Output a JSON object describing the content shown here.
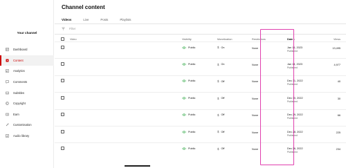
{
  "sidebar": {
    "channel_label": "Your channel",
    "items": [
      {
        "label": "Dashboard",
        "icon": "dashboard-icon"
      },
      {
        "label": "Content",
        "icon": "content-icon",
        "active": true
      },
      {
        "label": "Analytics",
        "icon": "analytics-icon"
      },
      {
        "label": "Comments",
        "icon": "comments-icon"
      },
      {
        "label": "Subtitles",
        "icon": "subtitles-icon"
      },
      {
        "label": "Copyright",
        "icon": "copyright-icon"
      },
      {
        "label": "Earn",
        "icon": "earn-icon"
      },
      {
        "label": "Customisation",
        "icon": "customisation-icon"
      },
      {
        "label": "Audio library",
        "icon": "audio-library-icon"
      }
    ]
  },
  "main": {
    "title": "Channel content",
    "tabs": [
      {
        "label": "Videos",
        "active": true
      },
      {
        "label": "Live"
      },
      {
        "label": "Posts"
      },
      {
        "label": "Playlists"
      }
    ],
    "filter_placeholder": "Filter"
  },
  "table": {
    "headers": {
      "video": "Video",
      "visibility": "Visibility",
      "monetization": "Monetization",
      "restrictions": "Restrictions",
      "date": "Date ↓",
      "views": "Views"
    },
    "rows": [
      {
        "visibility": "Public",
        "monetization": "On",
        "restrictions": "None",
        "date": "Jan 15, 2023",
        "date_status": "Published",
        "views": "13,495"
      },
      {
        "visibility": "Public",
        "monetization": "On",
        "restrictions": "None",
        "date": "Jan 14, 2023",
        "date_status": "Published",
        "views": "4,977"
      },
      {
        "visibility": "Public",
        "monetization": "Off",
        "restrictions": "None",
        "date": "Dec 31, 2022",
        "date_status": "Published",
        "views": "40"
      },
      {
        "visibility": "Public",
        "monetization": "Off",
        "restrictions": "None",
        "date": "Dec 30, 2022",
        "date_status": "Published",
        "views": "30"
      },
      {
        "visibility": "Public",
        "monetization": "Off",
        "restrictions": "None",
        "date": "Dec 29, 2022",
        "date_status": "Published",
        "views": "66"
      },
      {
        "visibility": "Public",
        "monetization": "Off",
        "restrictions": "None",
        "date": "Dec 28, 2022",
        "date_status": "Published",
        "views": "225"
      },
      {
        "visibility": "Public",
        "monetization": "Off",
        "restrictions": "None",
        "date": "Dec 26, 2022",
        "date_status": "Published",
        "views": "234"
      }
    ]
  },
  "colors": {
    "accent_red": "#cc0000",
    "highlight_pink": "#e03fae",
    "visibility_green": "#2ba640"
  }
}
